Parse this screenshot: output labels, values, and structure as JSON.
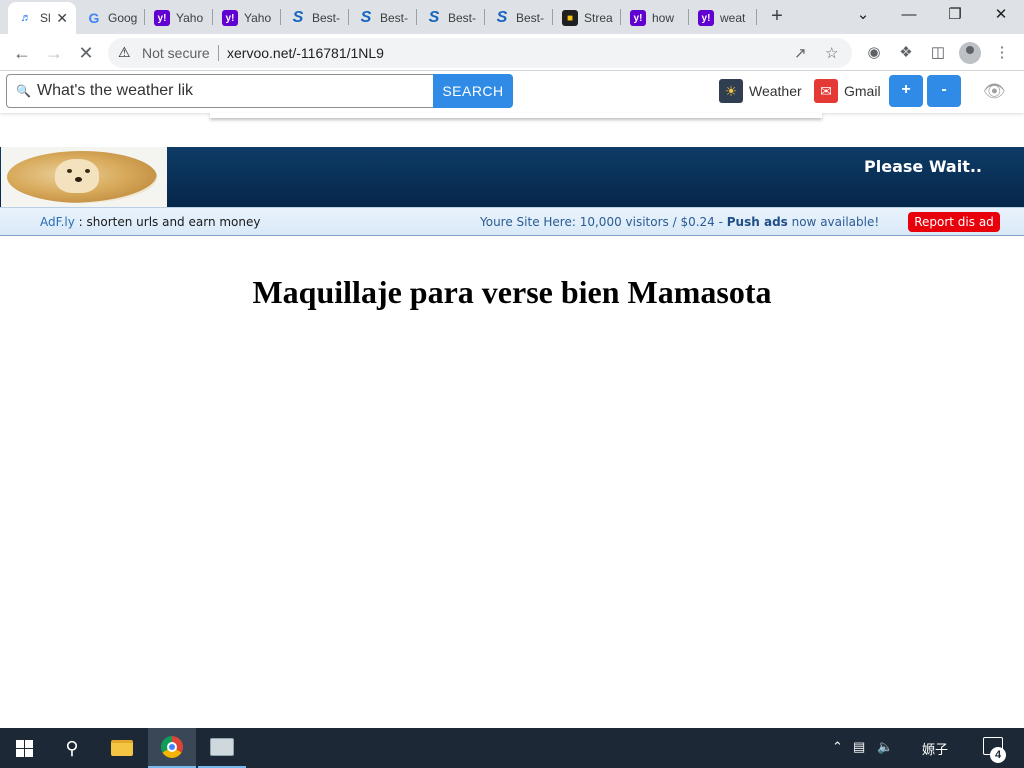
{
  "tabs": [
    {
      "title": "Sl",
      "favicon": "sl-favicon-icon",
      "active": true
    },
    {
      "title": "Goog",
      "favicon": "google-favicon-icon"
    },
    {
      "title": "Yaho",
      "favicon": "yahoo-favicon-icon"
    },
    {
      "title": "Yaho",
      "favicon": "yahoo-favicon-icon"
    },
    {
      "title": "Best-",
      "favicon": "s-favicon-icon"
    },
    {
      "title": "Best-",
      "favicon": "s-favicon-icon"
    },
    {
      "title": "Best-",
      "favicon": "s-favicon-icon"
    },
    {
      "title": "Best-",
      "favicon": "s-favicon-icon"
    },
    {
      "title": "Strea",
      "favicon": "cube-favicon-icon"
    },
    {
      "title": "how",
      "favicon": "yahoo-favicon-icon"
    },
    {
      "title": "weat",
      "favicon": "yahoo-favicon-icon"
    }
  ],
  "addressbar": {
    "security_label": "Not secure",
    "url": "xervoo.net/-116781/1NL9"
  },
  "extension": {
    "search_value": "What's the weather lik",
    "search_button": "SEARCH",
    "weather_label": "Weather",
    "gmail_label": "Gmail",
    "plus_label": "+",
    "minus_label": "-"
  },
  "adfly": {
    "please_wait": "Please Wait..",
    "brand": "AdF.ly",
    "tagline": " : shorten urls and earn money",
    "promo_text": "Youre Site Here: 10,000 visitors / $0.24 - ",
    "promo_bold": "Push ads",
    "promo_tail": " now available!",
    "report_label": "Report dis ad"
  },
  "page": {
    "title": "Maquillaje para verse bien Mamasota"
  },
  "taskbar": {
    "ime_label": "嫄子",
    "notification_count": "4"
  },
  "colors": {
    "accent_blue": "#2f8be6",
    "adfly_header": "#0e3c66",
    "report_red": "#e8000b",
    "taskbar": "#1c2836"
  }
}
